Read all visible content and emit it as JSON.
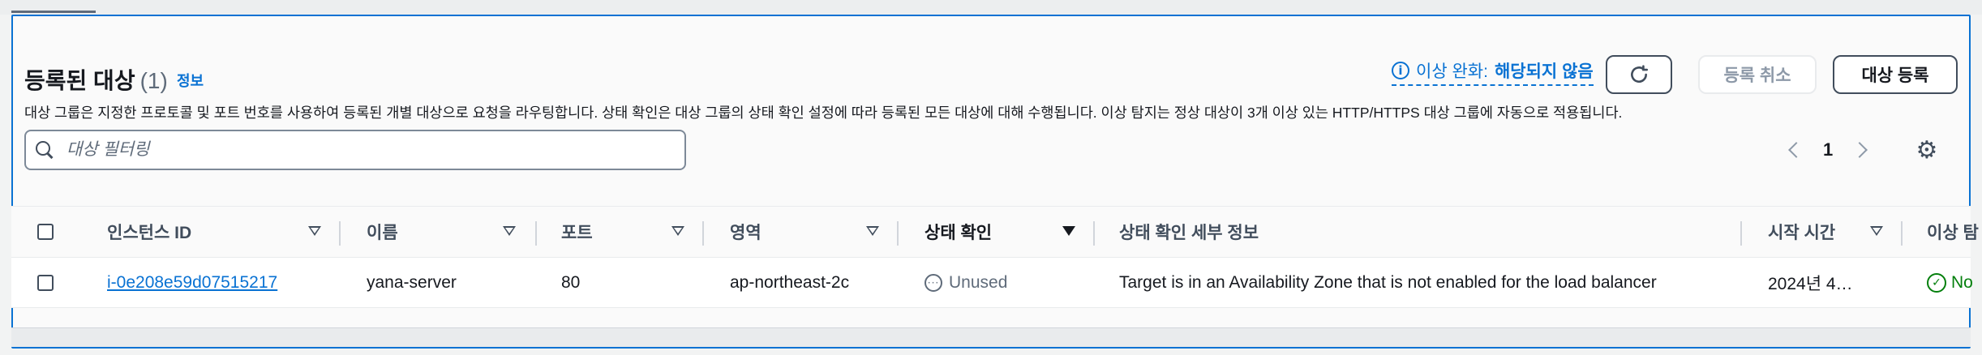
{
  "header": {
    "title": "등록된 대상",
    "count": "(1)",
    "info_link": "정보",
    "anomaly_label": "이상 완화:",
    "anomaly_value": "해당되지 않음",
    "cancel_label": "등록 취소",
    "register_label": "대상 등록",
    "description": "대상 그룹은 지정한 프로토콜 및 포트 번호를 사용하여 등록된 개별 대상으로 요청을 라우팅합니다. 상태 확인은 대상 그룹의 상태 확인 설정에 따라 등록된 모든 대상에 대해 수행됩니다. 이상 탐지는 정상 대상이 3개 이상 있는 HTTP/HTTPS 대상 그룹에 자동으로 적용됩니다."
  },
  "search": {
    "placeholder": "대상 필터링"
  },
  "pagination": {
    "current_page": "1"
  },
  "table": {
    "columns": [
      "인스턴스 ID",
      "이름",
      "포트",
      "영역",
      "상태 확인",
      "상태 확인 세부 정보",
      "시작 시간",
      "이상 탐"
    ],
    "rows": [
      {
        "instance_id": "i-0e208e59d07515217",
        "name": "yana-server",
        "port": "80",
        "zone": "ap-northeast-2c",
        "health": "Unused",
        "health_details": "Target is in an Availability Zone that is not enabled for the load balancer",
        "launch_time": "2024년 4…",
        "anomaly": "No"
      }
    ]
  },
  "colors": {
    "accent": "#0972d3",
    "success": "#037f0c",
    "text": "#16191f",
    "muted": "#5f6b7a"
  }
}
